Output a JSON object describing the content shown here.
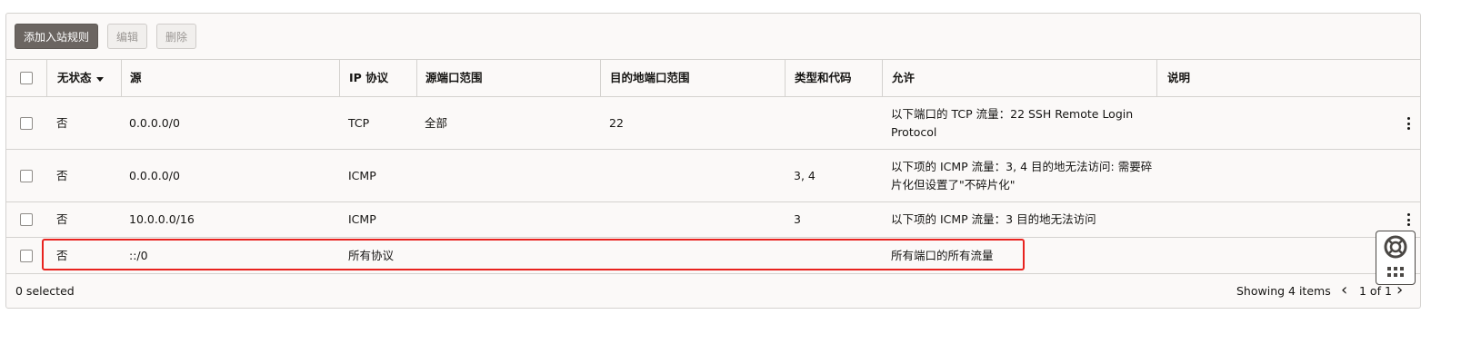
{
  "toolbar": {
    "add_rule_label": "添加入站规则",
    "edit_label": "编辑",
    "delete_label": "删除"
  },
  "table": {
    "columns": [
      "无状态",
      "源",
      "IP 协议",
      "源端口范围",
      "目的地端口范围",
      "类型和代码",
      "允许",
      "说明"
    ],
    "rows": [
      {
        "stateless": "否",
        "source": "0.0.0.0/0",
        "protocol": "TCP",
        "source_ports": "全部",
        "dest_ports": "22",
        "type_code": "",
        "allows": "以下端口的 TCP 流量：22 SSH Remote Login Protocol",
        "description": ""
      },
      {
        "stateless": "否",
        "source": "0.0.0.0/0",
        "protocol": "ICMP",
        "source_ports": "",
        "dest_ports": "",
        "type_code": "3, 4",
        "allows": "以下项的 ICMP 流量：3, 4 目的地无法访问: 需要碎片化但设置了\"不碎片化\"",
        "description": ""
      },
      {
        "stateless": "否",
        "source": "10.0.0.0/16",
        "protocol": "ICMP",
        "source_ports": "",
        "dest_ports": "",
        "type_code": "3",
        "allows": "以下项的 ICMP 流量：3 目的地无法访问",
        "description": ""
      },
      {
        "stateless": "否",
        "source": "::/0",
        "protocol": "所有协议",
        "source_ports": "",
        "dest_ports": "",
        "type_code": "",
        "allows": "所有端口的所有流量",
        "description": ""
      }
    ]
  },
  "footer": {
    "selected_text": "0 selected",
    "showing_text": "Showing 4 items",
    "page_text": "1 of 1"
  },
  "colors": {
    "highlight": "#e8231f",
    "primary_button": "#6b6561"
  }
}
